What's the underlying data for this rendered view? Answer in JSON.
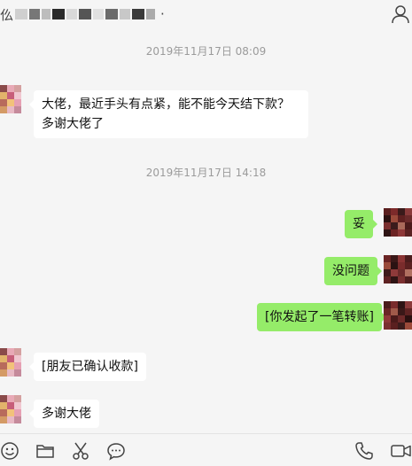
{
  "header": {
    "title_visible_char": "仫",
    "title_suffix": "·"
  },
  "messages": [
    {
      "kind": "timestamp",
      "text": "2019年11月17日 08:09"
    },
    {
      "kind": "incoming",
      "text": "大佬，最近手头有点紧，能不能今天结下款？多谢大佬了"
    },
    {
      "kind": "timestamp",
      "text": "2019年11月17日 14:18"
    },
    {
      "kind": "outgoing",
      "text": "妥"
    },
    {
      "kind": "outgoing",
      "text": "没问题"
    },
    {
      "kind": "outgoing",
      "text": "[你发起了一笔转账]"
    },
    {
      "kind": "incoming",
      "text": "[朋友已确认收款]"
    },
    {
      "kind": "incoming",
      "text": "多谢大佬"
    }
  ],
  "toolbar": {
    "icons": [
      "emoji-icon",
      "folder-icon",
      "scissors-icon",
      "chat-history-icon",
      "phone-icon",
      "video-icon"
    ]
  },
  "colors": {
    "outgoing_bubble": "#95ec69",
    "incoming_bubble": "#ffffff",
    "background": "#f5f5f5",
    "timestamp": "#9b9b9b"
  }
}
